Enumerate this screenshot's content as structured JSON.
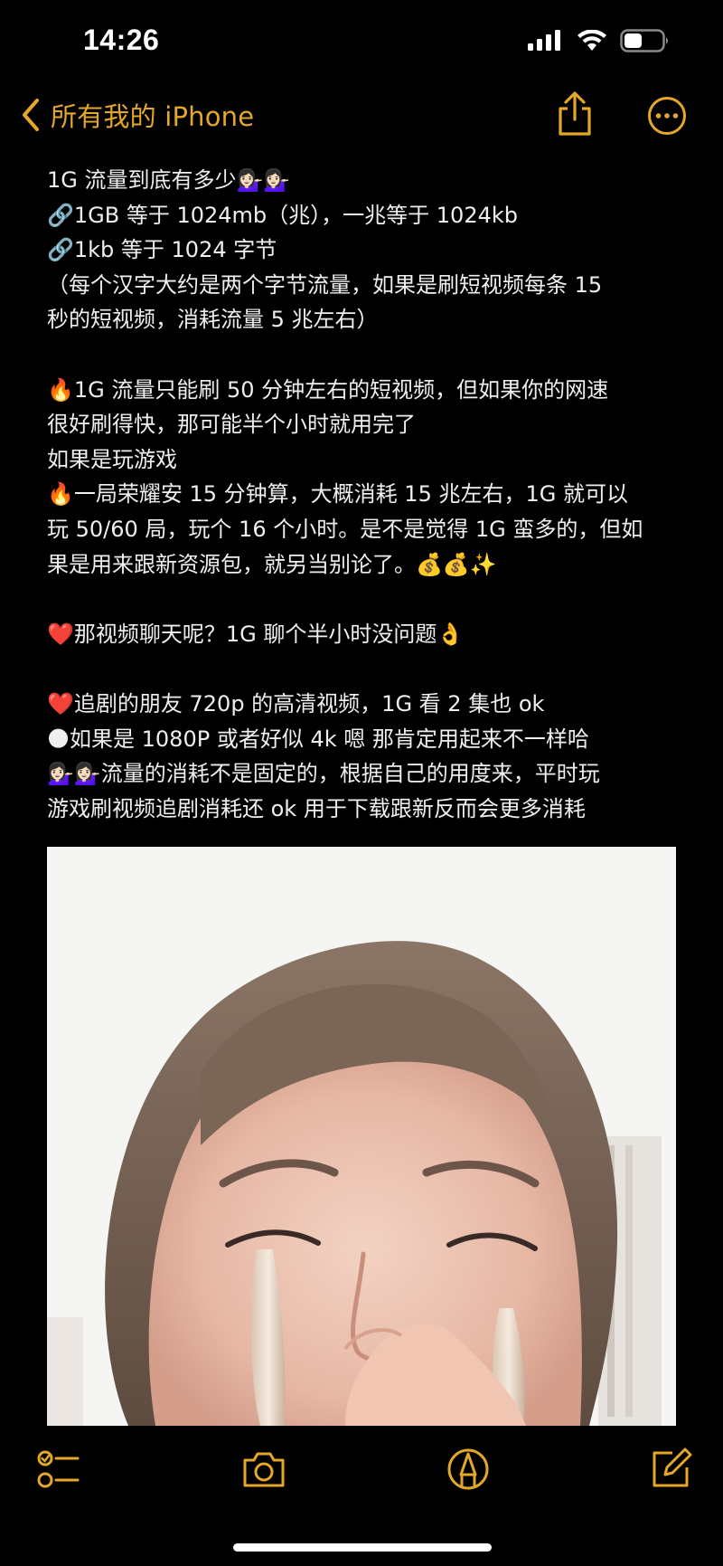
{
  "status_bar": {
    "time": "14:26"
  },
  "nav": {
    "back_label": "所有我的 iPhone",
    "accent_color": "#e3a72a"
  },
  "note": {
    "lines": [
      "1G 流量到底有多少💁🏻‍♀️💁🏻‍♀️",
      "🔗1GB 等于 1024mb（兆），一兆等于 1024kb",
      "🔗1kb 等于 1024 字节",
      "（每个汉字大约是两个字节流量，如果是刷短视频每条 15",
      "秒的短视频，消耗流量 5 兆左右）",
      "",
      "🔥1G 流量只能刷 50 分钟左右的短视频，但如果你的网速",
      "很好刷得快，那可能半个小时就用完了",
      "如果是玩游戏",
      "🔥一局荣耀安 15 分钟算，大概消耗 15 兆左右，1G 就可以",
      "玩 50/60 局，玩个 16 个小时。是不是觉得 1G 蛮多的，但如",
      "果是用来跟新资源包，就另当别论了。💰💰✨",
      "",
      "❤️那视频聊天呢？1G 聊个半小时没问题👌",
      "",
      "❤️追剧的朋友 720p 的高清视频，1G 看 2 集也 ok",
      "🌑如果是 1080P 或者好似 4k 嗯 那肯定用起来不一样哈",
      "💁🏻‍♀️💁🏻‍♀️流量的消耗不是固定的，根据自己的用度来，平时玩",
      "游戏刷视频追剧消耗还 ok 用于下载跟新反而会更多消耗"
    ]
  },
  "icons": {
    "back": "chevron-left-icon",
    "share": "share-icon",
    "more": "ellipsis-circle-icon",
    "checklist": "checklist-icon",
    "camera": "camera-icon",
    "markup": "markup-pen-icon",
    "compose": "compose-icon"
  }
}
